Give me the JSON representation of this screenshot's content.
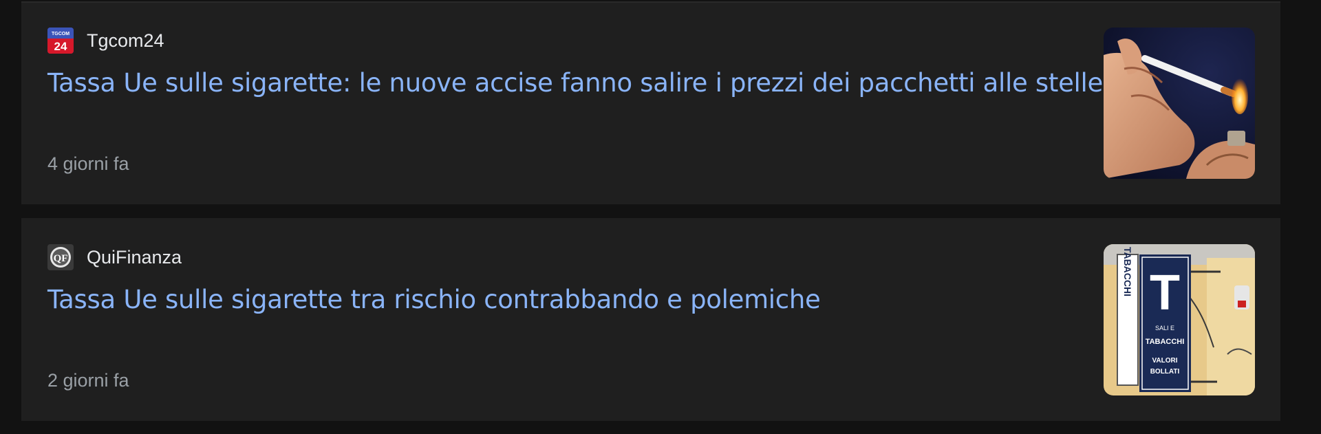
{
  "articles": [
    {
      "source": "Tgcom24",
      "favicon_icon": "tgcom24-logo-icon",
      "favicon_text_top": "TGCOM",
      "favicon_text_bottom": "24",
      "headline": "Tassa Ue sulle sigarette: le nuove accise fanno salire i prezzi dei pacchetti alle stelle",
      "time": "4 giorni fa",
      "thumbnail": "cigarette-lighter-photo"
    },
    {
      "source": "QuiFinanza",
      "favicon_icon": "quifinanza-logo-icon",
      "favicon_text": "QF",
      "headline": "Tassa Ue sulle sigarette tra rischio contrabbando e polemiche",
      "time": "2 giorni fa",
      "thumbnail": "tabacchi-sign-photo",
      "sign_letter": "T",
      "sign_vertical": "TABACCHI",
      "sign_lines": [
        "SALI E",
        "TABACCHI",
        "VALORI",
        "BOLLATI"
      ]
    }
  ],
  "colors": {
    "page_bg": "#121212",
    "card_bg": "#1f1f1f",
    "headline": "#8ab4f8",
    "source": "#e8eaed",
    "time": "#9aa0a6"
  }
}
